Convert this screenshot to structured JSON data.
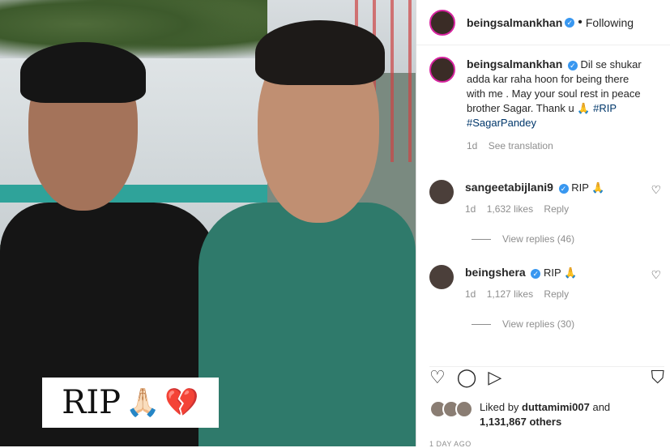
{
  "post_image": {
    "overlay_text": "RIP",
    "overlay_emojis": "🙏🏻",
    "overlay_heart": "💔"
  },
  "header": {
    "username": "beingsalmankhan",
    "verified_mark": "✓",
    "separator": "•",
    "follow_status": "Following"
  },
  "caption": {
    "username": "beingsalmankhan",
    "text": "Dil se shukar adda kar raha hoon for being there with me . May your soul rest in peace brother Sagar. Thank u 🙏 ",
    "tags": "#RIP #SagarPandey",
    "time": "1d",
    "translate": "See translation"
  },
  "comments": [
    {
      "username": "sangeetabijlani9",
      "text": "RIP 🙏",
      "time": "1d",
      "likes": "1,632 likes",
      "reply": "Reply",
      "view_replies": "View replies (46)"
    },
    {
      "username": "beingshera",
      "text": "RIP 🙏",
      "time": "1d",
      "likes": "1,127 likes",
      "reply": "Reply",
      "view_replies": "View replies (30)"
    }
  ],
  "actions": {
    "like_icon": "♡",
    "comment_icon": "◯",
    "share_icon": "▷",
    "save_icon": "⛉"
  },
  "likes_summary": {
    "prefix": "Liked by ",
    "user": "duttamimi007",
    "mid": " and",
    "count": "1,131,867 others"
  },
  "timestamp": "1 DAY AGO"
}
